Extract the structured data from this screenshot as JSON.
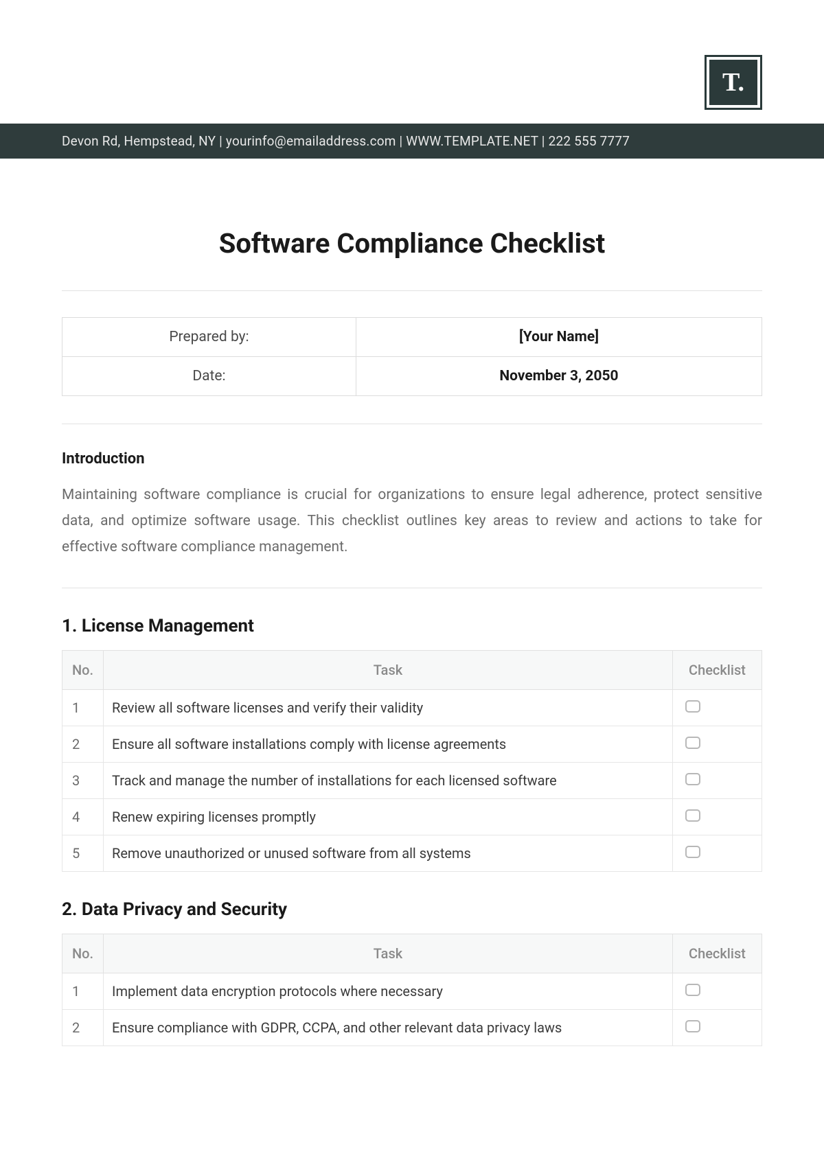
{
  "logo_text": "T.",
  "contact_bar": "Devon Rd, Hempstead, NY | yourinfo@emailaddress.com | WWW.TEMPLATE.NET | 222 555 7777",
  "title": "Software Compliance Checklist",
  "meta": {
    "prepared_by_label": "Prepared by:",
    "prepared_by_value": "[Your Name]",
    "date_label": "Date:",
    "date_value": "November 3, 2050"
  },
  "intro": {
    "heading": "Introduction",
    "text": "Maintaining software compliance is crucial for organizations to ensure legal adherence, protect sensitive data, and optimize software usage. This checklist outlines key areas to review and actions to take for effective software compliance management."
  },
  "headers": {
    "no": "No.",
    "task": "Task",
    "checklist": "Checklist"
  },
  "sections": [
    {
      "heading": "1. License Management",
      "rows": [
        {
          "no": "1",
          "task": "Review all software licenses and verify their validity"
        },
        {
          "no": "2",
          "task": "Ensure all software installations comply with license agreements"
        },
        {
          "no": "3",
          "task": "Track and manage the number of installations for each licensed software"
        },
        {
          "no": "4",
          "task": "Renew expiring licenses promptly"
        },
        {
          "no": "5",
          "task": "Remove unauthorized or unused software from all systems"
        }
      ]
    },
    {
      "heading": "2. Data Privacy and Security",
      "rows": [
        {
          "no": "1",
          "task": "Implement data encryption protocols where necessary"
        },
        {
          "no": "2",
          "task": "Ensure compliance with GDPR, CCPA, and other relevant data privacy laws"
        }
      ]
    }
  ]
}
